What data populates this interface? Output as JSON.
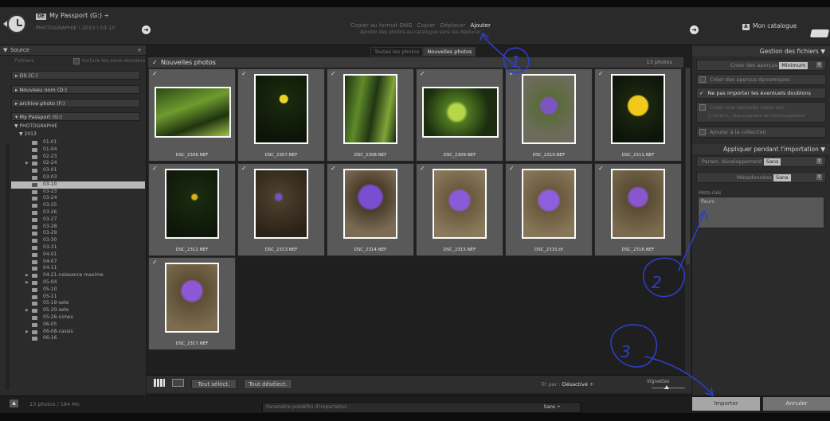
{
  "header": {
    "source_badge": "DE",
    "source_name": "My Passport (G:) ÷",
    "source_path": "PHOTOGRAPHIE \\ 2013 \\ 03-10",
    "modes": [
      "Copier au format DNG",
      "Copier",
      "Déplacer",
      "Ajouter"
    ],
    "active_mode": "Ajouter",
    "mode_desc": "Ajouter des photos au catalogue sans les déplacer",
    "dest_badge": "A",
    "dest_name": "Mon catalogue"
  },
  "source_panel": {
    "title": "Source",
    "files_label": "Fichiers",
    "include_sub": "Inclure les sous-dossiers",
    "volumes": [
      "OS (C:)",
      "Nouveau nom (D:)",
      "archive photo (F:)",
      "My Passport (G:)"
    ],
    "root_folder": "PHOTOGRAPHIE",
    "year_folder": "2013",
    "folders": [
      "01-01",
      "01-04",
      "02-23",
      "02-24",
      "03-01",
      "03-03",
      "03-10",
      "03-23",
      "03-24",
      "03-25",
      "03-26",
      "03-27",
      "03-28",
      "03-29",
      "03-30",
      "03-31",
      "04-01",
      "04-07",
      "04-11",
      "04-21-naissance maxime",
      "05-04",
      "05-10",
      "05-11",
      "05-19-sete",
      "05-20-sete",
      "05-26-nimes",
      "06-05",
      "06-08-cassis",
      "06-16"
    ],
    "selected_folder": "03-10"
  },
  "center": {
    "tabs": [
      "Toutes les photos",
      "Nouvelles photos"
    ],
    "active_tab": "Nouvelles photos",
    "group_title": "Nouvelles photos",
    "photo_count": "13 photos",
    "photos": [
      "DSC_2306.NEF",
      "DSC_2307.NEF",
      "DSC_2308.NEF",
      "DSC_2309.NEF",
      "DSC_2310.NEF",
      "DSC_2311.NEF",
      "DSC_2312.NEF",
      "DSC_2313.NEF",
      "DSC_2314.NEF",
      "DSC_2315.NEF",
      "DSC_2315.tif",
      "DSC_2316.NEF",
      "DSC_2317.NEF"
    ],
    "select_all": "Tout sélect.",
    "deselect_all": "Tout désélect.",
    "sort_label": "Tri par :",
    "sort_value": "Désactivé ÷",
    "thumbs_label": "Vignettes"
  },
  "right_panel": {
    "file_handling_title": "Gestion des fichiers",
    "previews_label": "Créer des aperçus",
    "previews_value": "Minimum",
    "smart_previews": "Créer des aperçus dynamiques",
    "no_duplicates": "Ne pas importer les éventuels doublons",
    "second_copy": "Créer une seconde copie sur :",
    "second_copy_path": "C:\\Users\\...\\Sauvegardes de téléchargement",
    "add_collection": "Ajouter à la collection",
    "apply_title": "Appliquer pendant l'importation",
    "develop_label": "Param. développement",
    "develop_value": "Sans",
    "metadata_label": "Métadonnées",
    "metadata_value": "Sans",
    "keywords_label": "Mots-clés",
    "keywords_value": "fleurs"
  },
  "bottom": {
    "selection_info": "13 photos / 184 Mo",
    "preset_label": "Paramètre prédéfini d'importation :",
    "preset_value": "Sans ÷",
    "import_label": "Importer",
    "cancel_label": "Annuler"
  },
  "annotations": [
    "1",
    "2",
    "3"
  ],
  "colors": {
    "annotation": "#2c3fc4",
    "selected_folder": "#b9b9b9",
    "import_button": "#a6a6a6"
  }
}
